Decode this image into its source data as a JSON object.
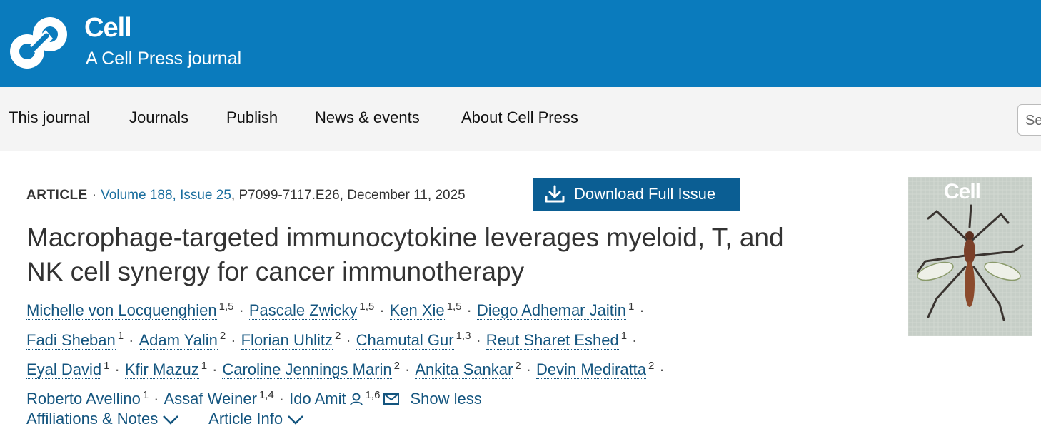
{
  "brand": {
    "name": "Cell",
    "subtitle": "A Cell Press journal",
    "color": "#0a7bbd"
  },
  "nav": {
    "items": [
      "This journal",
      "Journals",
      "Publish",
      "News & events",
      "About Cell Press"
    ],
    "search_placeholder": "Se"
  },
  "article": {
    "type": "ARTICLE",
    "volume_issue": "Volume 188, Issue 25",
    "pages_date": "P7099-7117.E26, December 11, 2025",
    "download_label": "Download Full Issue",
    "title": "Macrophage-targeted immunocytokine leverages myeloid, T, and NK cell synergy for cancer immunotherapy",
    "authors": [
      {
        "name": "Michelle von Locquenghien",
        "aff": "1,5"
      },
      {
        "name": "Pascale Zwicky",
        "aff": "1,5"
      },
      {
        "name": "Ken Xie",
        "aff": "1,5"
      },
      {
        "name": "Diego Adhemar Jaitin",
        "aff": "1"
      },
      {
        "name": "Fadi Sheban",
        "aff": "1"
      },
      {
        "name": "Adam Yalin",
        "aff": "2"
      },
      {
        "name": "Florian Uhlitz",
        "aff": "2"
      },
      {
        "name": "Chamutal Gur",
        "aff": "1,3"
      },
      {
        "name": "Reut Sharet Eshed",
        "aff": "1"
      },
      {
        "name": "Eyal David",
        "aff": "1"
      },
      {
        "name": "Kfir Mazuz",
        "aff": "1"
      },
      {
        "name": "Caroline Jennings Marin",
        "aff": "2"
      },
      {
        "name": "Ankita Sankar",
        "aff": "2"
      },
      {
        "name": "Devin Mediratta",
        "aff": "2"
      },
      {
        "name": "Roberto Avellino",
        "aff": "1"
      },
      {
        "name": "Assaf Weiner",
        "aff": "1,4"
      },
      {
        "name": "Ido Amit",
        "aff": "1,6"
      }
    ],
    "show_less": "Show less",
    "expanders": [
      "Affiliations & Notes",
      "Article Info"
    ]
  },
  "cover": {
    "journal_name": "Cell"
  }
}
